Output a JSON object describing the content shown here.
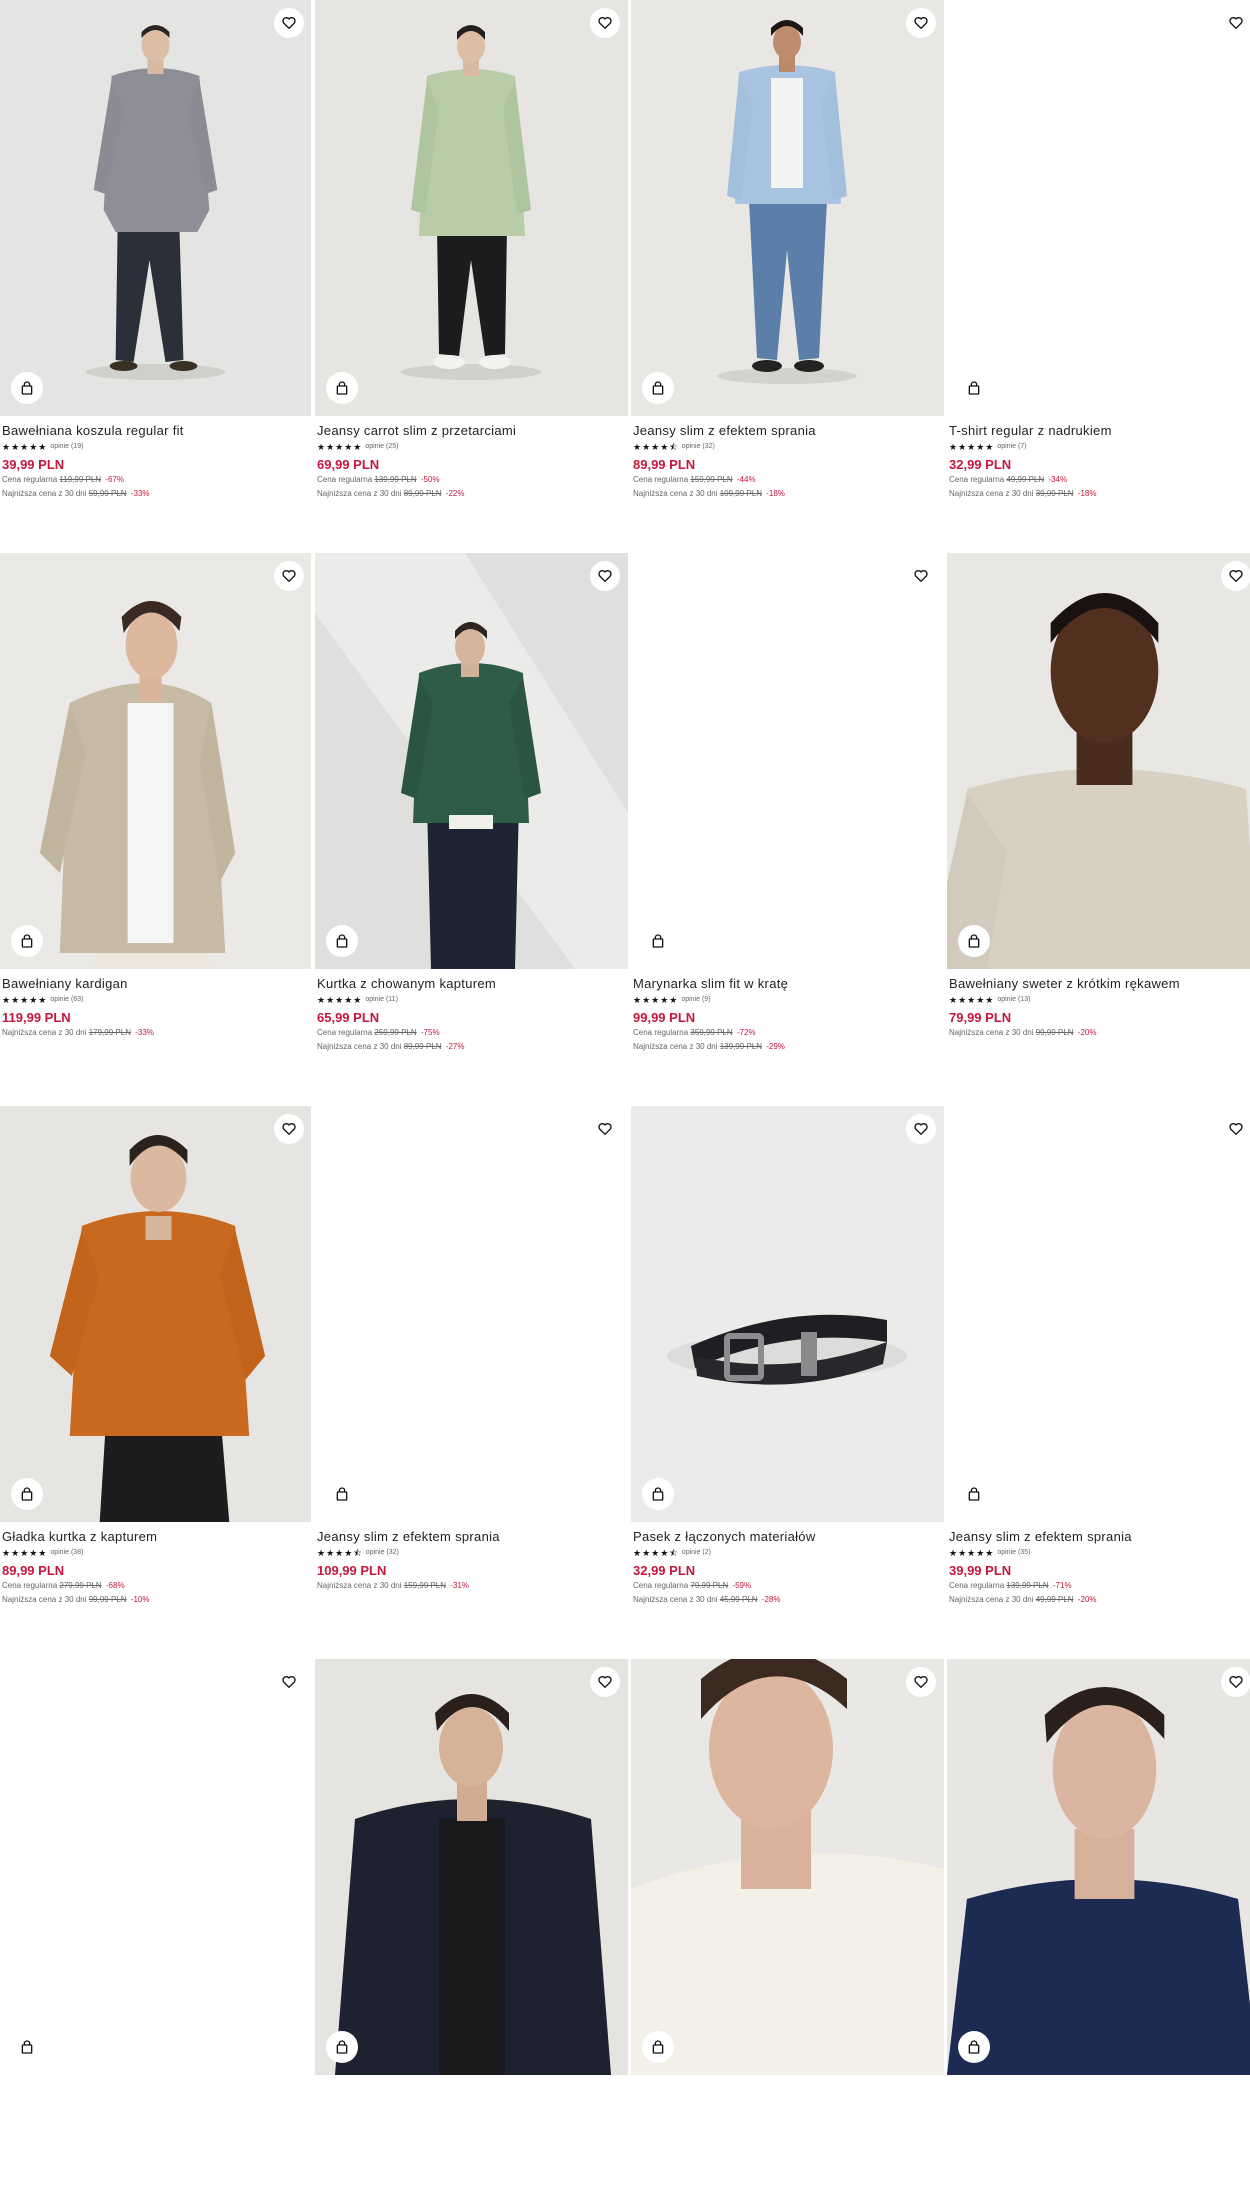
{
  "labels": {
    "regular": "Cena regularna",
    "lowest": "Najniższa cena z 30 dni"
  },
  "products": [
    {
      "name": "Bawełniana koszula regular fit",
      "stars": "★★★★★",
      "reviews": "opinie (19)",
      "price": "39,99 PLN",
      "regular_old": "119,99 PLN",
      "regular_disc": "-67%",
      "lowest_old": "59,99 PLN",
      "lowest_disc": "-33%",
      "photo": "shirt-check"
    },
    {
      "name": "Jeansy carrot slim z przetarciami",
      "stars": "★★★★★",
      "reviews": "opinie (25)",
      "price": "69,99 PLN",
      "regular_old": "139,99 PLN",
      "regular_disc": "-50%",
      "lowest_old": "89,99 PLN",
      "lowest_disc": "-22%",
      "photo": "green-overshirt"
    },
    {
      "name": "Jeansy slim z efektem sprania",
      "stars": "★★★★⯪",
      "reviews": "opinie (32)",
      "price": "89,99 PLN",
      "regular_old": "159,99 PLN",
      "regular_disc": "-44%",
      "lowest_old": "109,99 PLN",
      "lowest_disc": "-18%",
      "photo": "blue-denim"
    },
    {
      "name": "T-shirt regular z nadrukiem",
      "stars": "★★★★★",
      "reviews": "opinie (7)",
      "price": "32,99 PLN",
      "regular_old": "49,99 PLN",
      "regular_disc": "-34%",
      "lowest_old": "39,99 PLN",
      "lowest_disc": "-18%",
      "photo": "blank"
    },
    {
      "name": "Bawełniany kardigan",
      "stars": "★★★★★",
      "reviews": "opinie (63)",
      "price": "119,99 PLN",
      "regular_old": "",
      "regular_disc": "",
      "lowest_old": "179,99 PLN",
      "lowest_disc": "-33%",
      "photo": "cardigan"
    },
    {
      "name": "Kurtka z chowanym kapturem",
      "stars": "★★★★★",
      "reviews": "opinie (11)",
      "price": "65,99 PLN",
      "regular_old": "259,99 PLN",
      "regular_disc": "-75%",
      "lowest_old": "89,99 PLN",
      "lowest_disc": "-27%",
      "photo": "green-jacket"
    },
    {
      "name": "Marynarka slim fit w kratę",
      "stars": "★★★★★",
      "reviews": "opinie (9)",
      "price": "99,99 PLN",
      "regular_old": "359,99 PLN",
      "regular_disc": "-72%",
      "lowest_old": "139,99 PLN",
      "lowest_disc": "-29%",
      "photo": "blank"
    },
    {
      "name": "Bawełniany sweter z krótkim rękawem",
      "stars": "★★★★★",
      "reviews": "opinie (13)",
      "price": "79,99 PLN",
      "regular_old": "",
      "regular_disc": "",
      "lowest_old": "99,99 PLN",
      "lowest_disc": "-20%",
      "photo": "beige-sweater"
    },
    {
      "name": "Gładka kurtka z kapturem",
      "stars": "★★★★★",
      "reviews": "opinie (38)",
      "price": "89,99 PLN",
      "regular_old": "279,99 PLN",
      "regular_disc": "-68%",
      "lowest_old": "99,99 PLN",
      "lowest_disc": "-10%",
      "photo": "orange-jacket"
    },
    {
      "name": "Jeansy slim z efektem sprania",
      "stars": "★★★★⯪",
      "reviews": "opinie (32)",
      "price": "109,99 PLN",
      "regular_old": "",
      "regular_disc": "",
      "lowest_old": "159,99 PLN",
      "lowest_disc": "-31%",
      "photo": "blank"
    },
    {
      "name": "Pasek z łączonych materiałów",
      "stars": "★★★★⯪",
      "reviews": "opinie (2)",
      "price": "32,99 PLN",
      "regular_old": "79,99 PLN",
      "regular_disc": "-59%",
      "lowest_old": "45,99 PLN",
      "lowest_disc": "-28%",
      "photo": "belt"
    },
    {
      "name": "Jeansy slim z efektem sprania",
      "stars": "★★★★★",
      "reviews": "opinie (35)",
      "price": "39,99 PLN",
      "regular_old": "139,99 PLN",
      "regular_disc": "-71%",
      "lowest_old": "49,99 PLN",
      "lowest_disc": "-20%",
      "photo": "blank"
    },
    {
      "name": "",
      "stars": "",
      "reviews": "",
      "price": "",
      "regular_old": "",
      "regular_disc": "",
      "lowest_old": "",
      "lowest_disc": "",
      "photo": "blank"
    },
    {
      "name": "",
      "stars": "",
      "reviews": "",
      "price": "",
      "regular_old": "",
      "regular_disc": "",
      "lowest_old": "",
      "lowest_disc": "",
      "photo": "navy-blazer"
    },
    {
      "name": "",
      "stars": "",
      "reviews": "",
      "price": "",
      "regular_old": "",
      "regular_disc": "",
      "lowest_old": "",
      "lowest_disc": "",
      "photo": "cream-tee"
    },
    {
      "name": "",
      "stars": "",
      "reviews": "",
      "price": "",
      "regular_old": "",
      "regular_disc": "",
      "lowest_old": "",
      "lowest_disc": "",
      "photo": "navy-tee"
    }
  ],
  "icons": {
    "wishlist": "heart-icon",
    "cart": "shopping-bag-icon"
  },
  "colors": {
    "price": "#c5173c",
    "text": "#222222",
    "muted": "#666666"
  }
}
